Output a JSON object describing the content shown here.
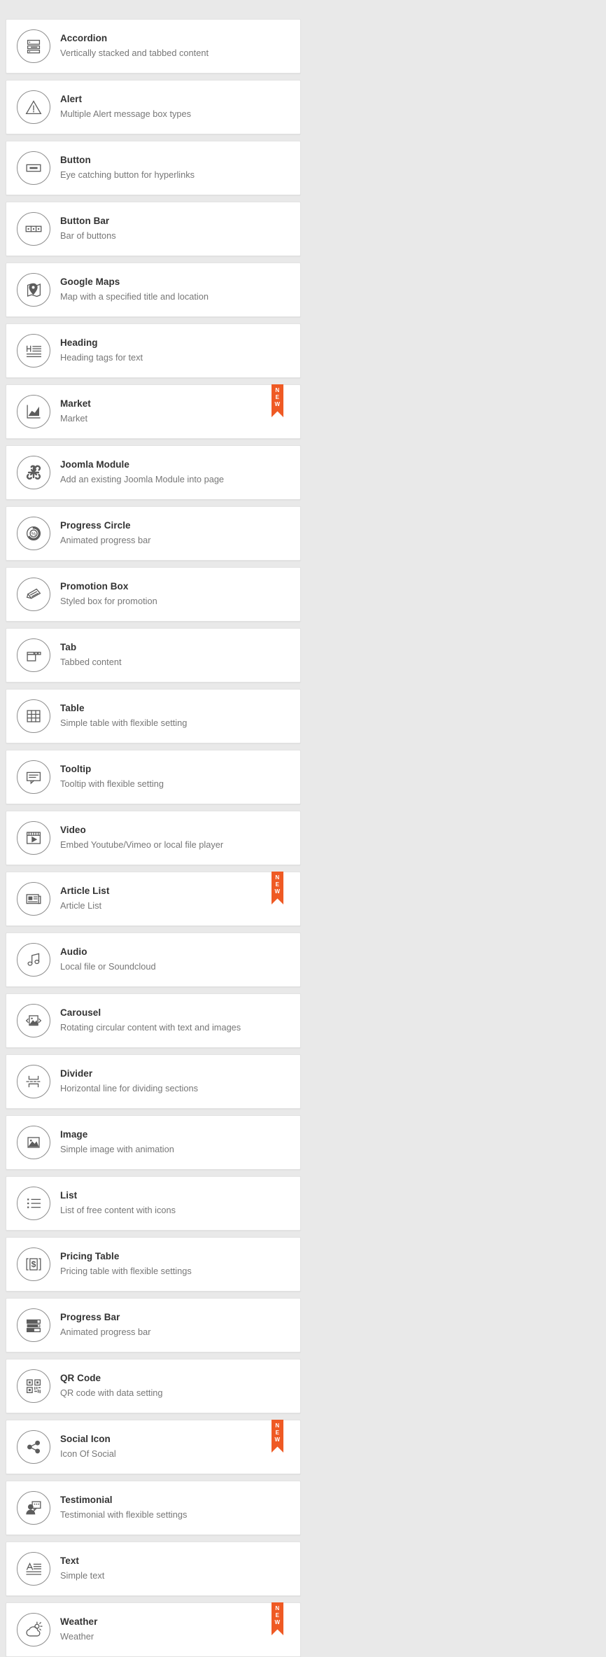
{
  "theme": {
    "page_background": "#e9e9e9",
    "card_background": "#ffffff",
    "card_border": "#e2e2e2",
    "title_color": "#333333",
    "description_color": "#777777",
    "icon_color": "#5c5c5c",
    "badge_color": "#ef5a24",
    "badge_text_color": "#ffffff"
  },
  "badge": {
    "label": "NEW",
    "letters": [
      "N",
      "E",
      "W"
    ]
  },
  "cards": [
    {
      "title": "Accordion",
      "description": "Vertically stacked and tabbed content",
      "icon": "accordion-icon",
      "new": false
    },
    {
      "title": "Alert",
      "description": "Multiple Alert message box types",
      "icon": "alert-triangle-icon",
      "new": false
    },
    {
      "title": "Button",
      "description": "Eye catching button for hyperlinks",
      "icon": "button-icon",
      "new": false
    },
    {
      "title": "Button Bar",
      "description": "Bar of buttons",
      "icon": "button-bar-icon",
      "new": false
    },
    {
      "title": "Google Maps",
      "description": "Map with a specified title and location",
      "icon": "map-pin-icon",
      "new": false
    },
    {
      "title": "Heading",
      "description": "Heading tags for text",
      "icon": "heading-icon",
      "new": false
    },
    {
      "title": "Market",
      "description": "Market",
      "icon": "market-chart-icon",
      "new": true
    },
    {
      "title": "Joomla Module",
      "description": "Add an existing Joomla Module into page",
      "icon": "joomla-icon",
      "new": false
    },
    {
      "title": "Progress Circle",
      "description": "Animated progress bar",
      "icon": "progress-circle-icon",
      "new": false
    },
    {
      "title": "Promotion Box",
      "description": "Styled box for promotion",
      "icon": "ticket-icon",
      "new": false
    },
    {
      "title": "Tab",
      "description": "Tabbed content",
      "icon": "tab-icon",
      "new": false
    },
    {
      "title": "Table",
      "description": "Simple table with flexible setting",
      "icon": "table-grid-icon",
      "new": false
    },
    {
      "title": "Tooltip",
      "description": "Tooltip with flexible setting",
      "icon": "tooltip-icon",
      "new": false
    },
    {
      "title": "Video",
      "description": "Embed Youtube/Vimeo or local file player",
      "icon": "video-player-icon",
      "new": false
    },
    {
      "title": "Article List",
      "description": "Article List",
      "icon": "newspaper-icon",
      "new": true
    },
    {
      "title": "Audio",
      "description": "Local file or Soundcloud",
      "icon": "music-note-icon",
      "new": false
    },
    {
      "title": "Carousel",
      "description": "Rotating circular content with text and images",
      "icon": "carousel-icon",
      "new": false
    },
    {
      "title": "Divider",
      "description": "Horizontal line for dividing sections",
      "icon": "divider-icon",
      "new": false
    },
    {
      "title": "Image",
      "description": "Simple image with animation",
      "icon": "image-icon",
      "new": false
    },
    {
      "title": "List",
      "description": "List of free content with icons",
      "icon": "list-icon",
      "new": false
    },
    {
      "title": "Pricing Table",
      "description": "Pricing table with flexible settings",
      "icon": "pricing-dollar-icon",
      "new": false
    },
    {
      "title": "Progress Bar",
      "description": "Animated progress bar",
      "icon": "progress-bar-icon",
      "new": false
    },
    {
      "title": "QR Code",
      "description": "QR code with data setting",
      "icon": "qr-code-icon",
      "new": false
    },
    {
      "title": "Social Icon",
      "description": "Icon Of Social",
      "icon": "share-icon",
      "new": true
    },
    {
      "title": "Testimonial",
      "description": "Testimonial with flexible settings",
      "icon": "testimonial-icon",
      "new": false
    },
    {
      "title": "Text",
      "description": "Simple text",
      "icon": "text-icon",
      "new": false
    },
    {
      "title": "Weather",
      "description": "Weather",
      "icon": "weather-cloud-sun-icon",
      "new": true
    }
  ]
}
